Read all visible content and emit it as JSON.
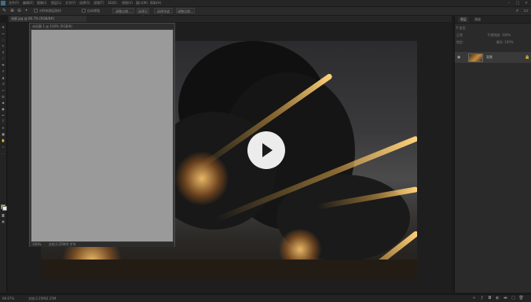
{
  "menubar": {
    "items": [
      "文件(F)",
      "编辑(E)",
      "图像(I)",
      "图层(L)",
      "文字(Y)",
      "选择(S)",
      "滤镜(T)",
      "3D(D)",
      "视图(V)",
      "窗口(W)",
      "帮助(H)"
    ]
  },
  "options": {
    "sample_all_layers": "对所有图层取样",
    "auto_enhance": "自动增强",
    "refine_edge": "调整边缘...",
    "select_subject": "选择主体",
    "select_mask": "选择并遮住..."
  },
  "document": {
    "tab_label": "流星.jpg @ 66.7% (RGB/8#)"
  },
  "floating_window": {
    "title": "未标题-1 @ 100% (RGB/8)",
    "zoom": "100%",
    "info": "文档:2.25M/0 字节"
  },
  "video": {
    "play_icon": "play-icon"
  },
  "panel": {
    "tabs": [
      "图层",
      "通道"
    ],
    "filter_label": "P 类型",
    "blend_label": "正常",
    "opacity_label": "不透明度: 100%",
    "lock_label": "锁定:",
    "fill_label": "填充: 100%",
    "layer_name": "背景"
  },
  "status": {
    "zoom": "66.67%",
    "doc": "文档:2.25M/2.25M"
  },
  "colors": {
    "foreground": "#c8a93a",
    "background": "#eeeeee"
  }
}
